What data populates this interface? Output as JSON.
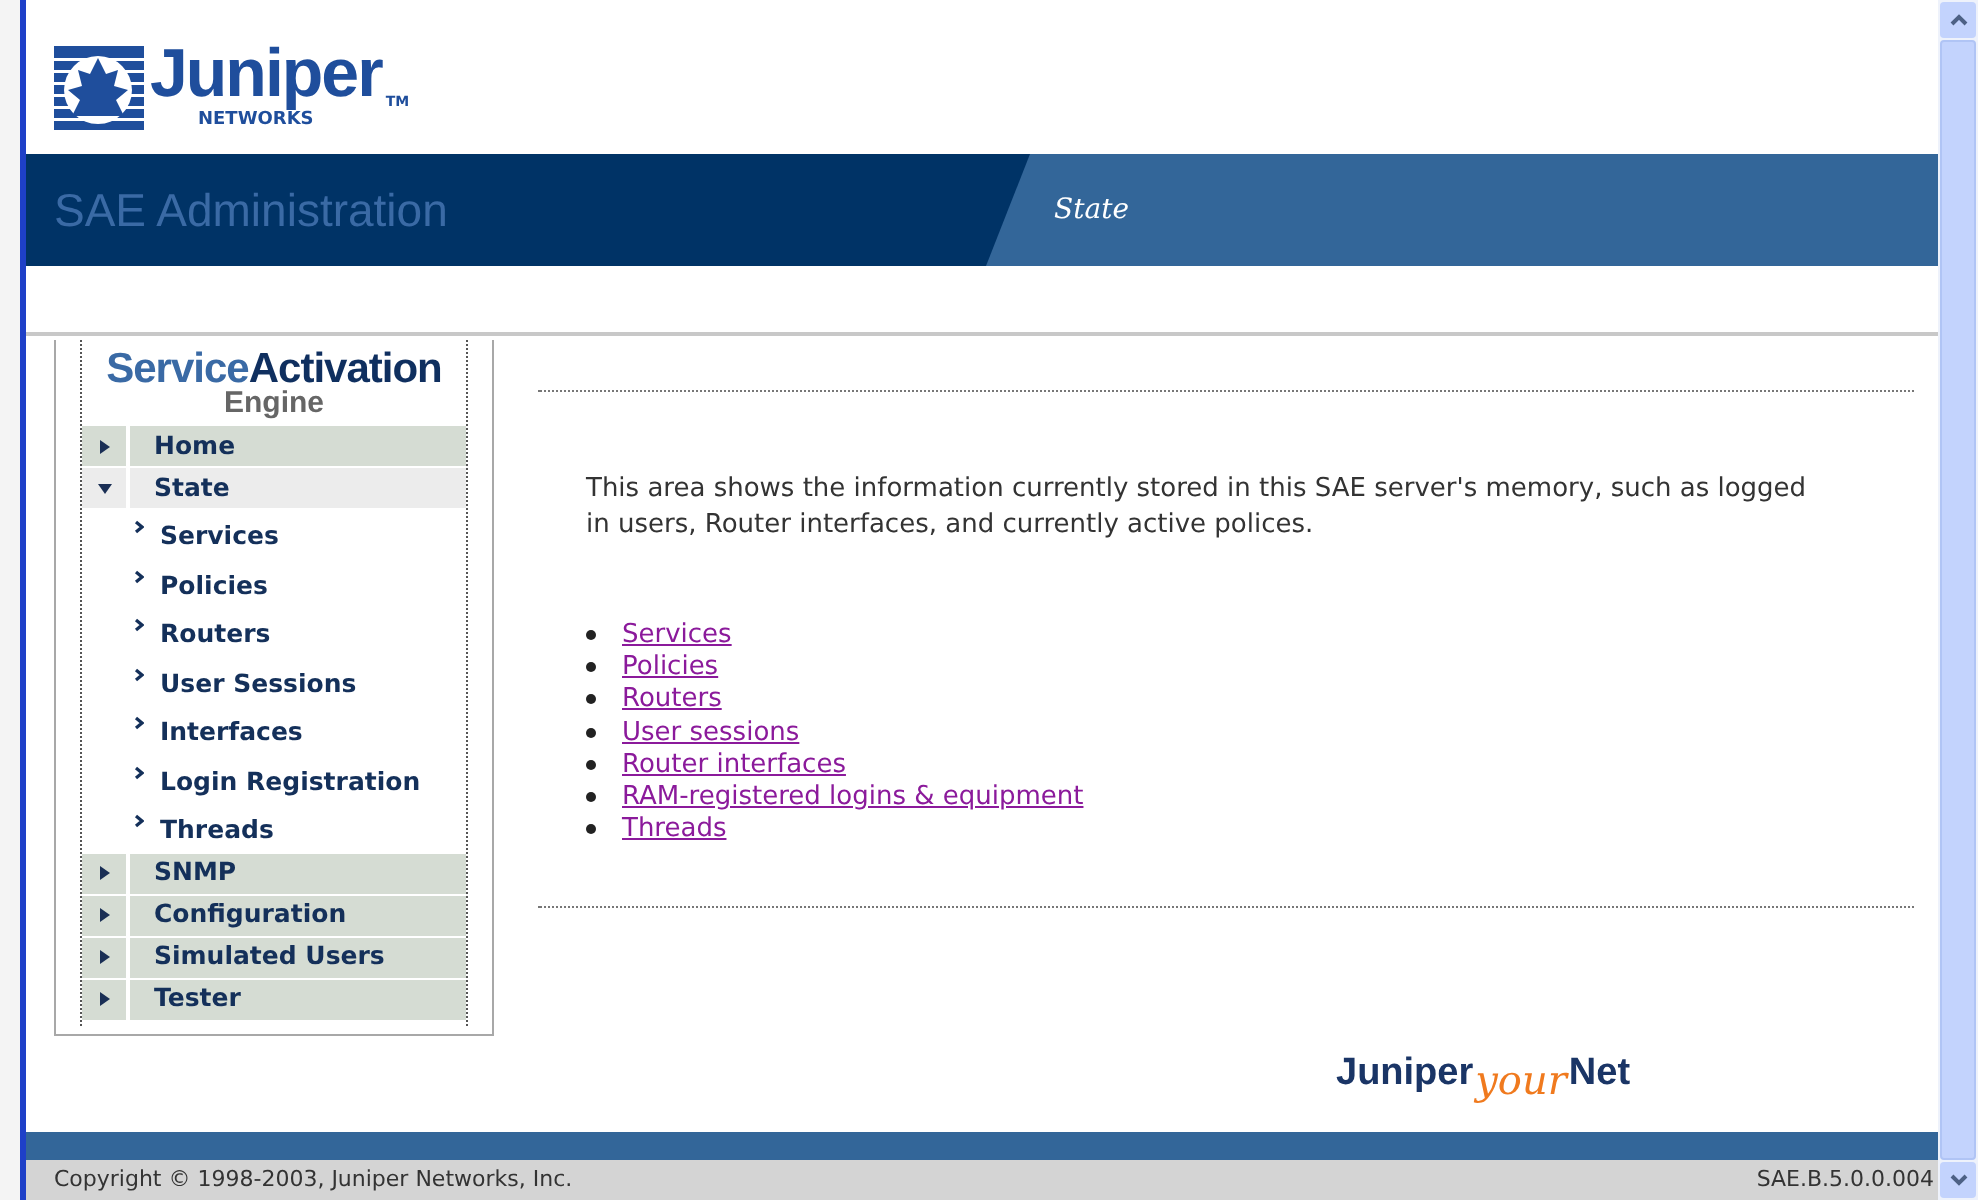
{
  "logo": {
    "name": "Juniper",
    "sub": "NETWORKS",
    "tm": "TM"
  },
  "banner": {
    "title": "SAE Administration",
    "section": "State"
  },
  "sidebar": {
    "product": {
      "part1": "Service",
      "part2": "Activation",
      "part3": "Engine"
    },
    "items": [
      {
        "label": "Home",
        "expanded": false,
        "selected": false
      },
      {
        "label": "State",
        "expanded": true,
        "selected": true,
        "children": [
          {
            "label": "Services"
          },
          {
            "label": "Policies"
          },
          {
            "label": "Routers"
          },
          {
            "label": "User Sessions"
          },
          {
            "label": "Interfaces"
          },
          {
            "label": "Login Registration"
          },
          {
            "label": "Threads"
          }
        ]
      },
      {
        "label": "SNMP",
        "expanded": false,
        "selected": false
      },
      {
        "label": "Configuration",
        "expanded": false,
        "selected": false
      },
      {
        "label": "Simulated Users",
        "expanded": false,
        "selected": false
      },
      {
        "label": "Tester",
        "expanded": false,
        "selected": false
      }
    ]
  },
  "content": {
    "description": "This area shows the information currently stored in this SAE server's memory, such as logged in users, Router interfaces, and currently active polices.",
    "links": [
      "Services",
      "Policies",
      "Routers",
      "User sessions",
      "Router interfaces",
      "RAM-registered logins & equipment",
      "Threads"
    ]
  },
  "slogan": {
    "part1": "Juniper",
    "part2": "your",
    "part3": "Net"
  },
  "status_bar": {
    "copyright": "Copyright © 1998-2003, Juniper Networks, Inc.",
    "version": "SAE.B.5.0.0.004"
  }
}
